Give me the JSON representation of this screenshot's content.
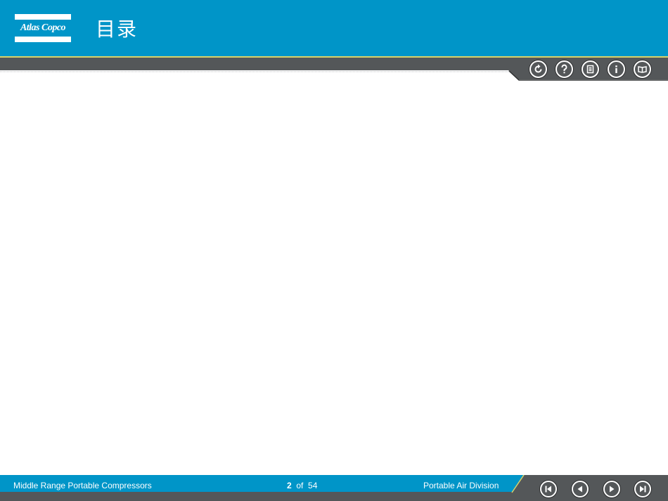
{
  "header": {
    "logo_text": "Atlas Copco",
    "title": "目录"
  },
  "toolbar": {
    "icons": [
      "refresh-icon",
      "help-icon",
      "contents-icon",
      "info-icon",
      "book-icon"
    ]
  },
  "footer": {
    "left_text": "Middle Range Portable Compressors",
    "page_current": "2",
    "page_of": "of",
    "page_total": "54",
    "right_text": "Portable Air Division",
    "nav_icons": [
      "first-page-icon",
      "previous-page-icon",
      "next-page-icon",
      "last-page-icon"
    ]
  },
  "colors": {
    "brand_blue": "#0095c8",
    "accent_yellow": "#d8d36a",
    "bar_gray": "#545759"
  }
}
